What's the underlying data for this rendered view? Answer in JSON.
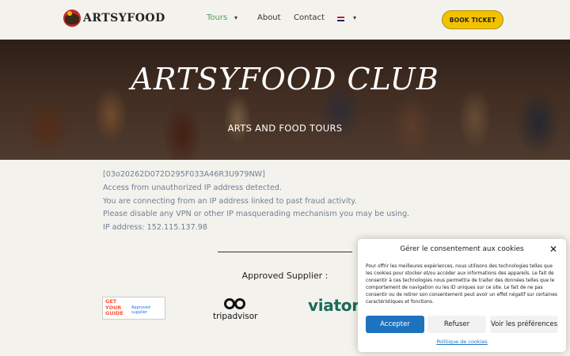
{
  "brand": {
    "logo_text": "ARTSYFOOD"
  },
  "nav": {
    "items": [
      {
        "label": "Tours",
        "active": true,
        "has_dropdown": true
      },
      {
        "label": "About"
      },
      {
        "label": "Contact"
      }
    ],
    "language_icon": "uk-flag-icon",
    "book_label": "BOOK TICKET"
  },
  "hero": {
    "title": "ARTSYFOOD CLUB",
    "subtitle": "ARTS AND FOOD TOURS"
  },
  "message": {
    "lines": [
      "[03o20262D072D295F033A46R3U979NW]",
      "Access from unauthorized IP address detected.",
      "You are connecting from an IP address linked to past fraud activity.",
      "Please disable any VPN or other IP masquerading mechanism you may be using.",
      "IP address: 152.115.137.98"
    ]
  },
  "suppliers": {
    "heading": "Approved Supplier :",
    "gyg": {
      "mark": "GET YOUR GUIDE",
      "badge": "Approved supplier"
    },
    "tripadvisor": "tripadvisor",
    "viator": "viator"
  },
  "consent": {
    "title": "Gérer le consentement aux cookies",
    "body": "Pour offrir les meilleures expériences, nous utilisons des technologies telles que les cookies pour stocker et/ou accéder aux informations des appareils. Le fait de consentir à ces technologies nous permettra de traiter des données telles que le comportement de navigation ou les ID uniques sur ce site. Le fait de ne pas consentir ou de retirer son consentement peut avoir un effet négatif sur certaines caractéristiques et fonctions.",
    "accept": "Accepter",
    "refuse": "Refuser",
    "prefs": "Voir les préférences",
    "policy": "Politique de cookies"
  },
  "colors": {
    "accent_green": "#5b9a62",
    "book_yellow": "#f2c200",
    "link_blue": "#1e73be",
    "message_text": "#6f7f95"
  }
}
